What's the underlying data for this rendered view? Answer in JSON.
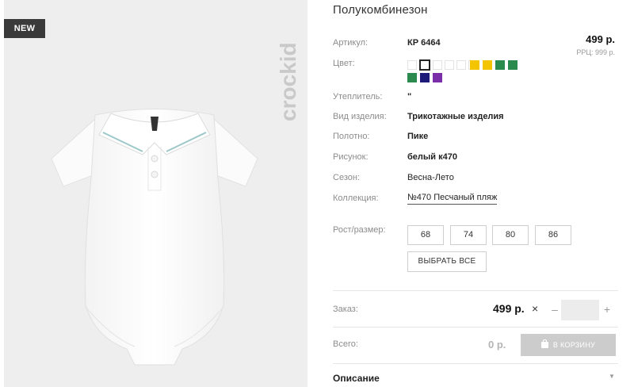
{
  "badge": {
    "new": "NEW"
  },
  "brand": {
    "logo_text": "crockid"
  },
  "product": {
    "title": "Полукомбинезон",
    "price": "499 р.",
    "rrp": "РРЦ: 999 р."
  },
  "attributes": [
    {
      "label": "Артикул:",
      "value": "КР 6464",
      "style": "bold"
    },
    {
      "label": "Цвет:",
      "value": ""
    },
    {
      "label": "Утеплитель:",
      "value": "\"",
      "style": "bold"
    },
    {
      "label": "Вид изделия:",
      "value": "Трикотажные изделия",
      "style": "bold"
    },
    {
      "label": "Полотно:",
      "value": "Пике",
      "style": "bold"
    },
    {
      "label": "Рисунок:",
      "value": "белый к470",
      "style": "bold"
    },
    {
      "label": "Сезон:",
      "value": "Весна-Лето",
      "style": "normal"
    },
    {
      "label": "Коллекция:",
      "value": "№470 Песчаный пляж",
      "style": "link"
    }
  ],
  "colors": [
    {
      "hex": "#ffffff",
      "selected": false
    },
    {
      "hex": "#ffffff",
      "selected": true
    },
    {
      "hex": "#ffffff",
      "selected": false
    },
    {
      "hex": "#ffffff",
      "selected": false
    },
    {
      "hex": "#ffffff",
      "selected": false
    },
    {
      "hex": "#ffffff",
      "selected": false
    },
    {
      "hex": "#f2c500",
      "selected": false
    },
    {
      "hex": "#f2c500",
      "selected": false
    },
    {
      "hex": "#2b8a4e",
      "selected": false
    },
    {
      "hex": "#2b8a4e",
      "selected": false
    },
    {
      "hex": "#2b8a4e",
      "selected": false
    },
    {
      "hex": "#1d1a7a",
      "selected": false
    },
    {
      "hex": "#7a2fa8",
      "selected": false
    }
  ],
  "sizes": {
    "label": "Рост/размер:",
    "options": [
      "68",
      "74",
      "80",
      "86"
    ],
    "select_all": "ВЫБРАТЬ ВСЕ"
  },
  "order": {
    "label": "Заказ:",
    "price": "499 р.",
    "times": "×",
    "minus": "–",
    "plus": "+",
    "quantity": ""
  },
  "total": {
    "label": "Всего:",
    "value": "0 р.",
    "cart_button": "В КОРЗИНУ"
  },
  "description": {
    "title": "Описание",
    "chevron": "▼"
  }
}
